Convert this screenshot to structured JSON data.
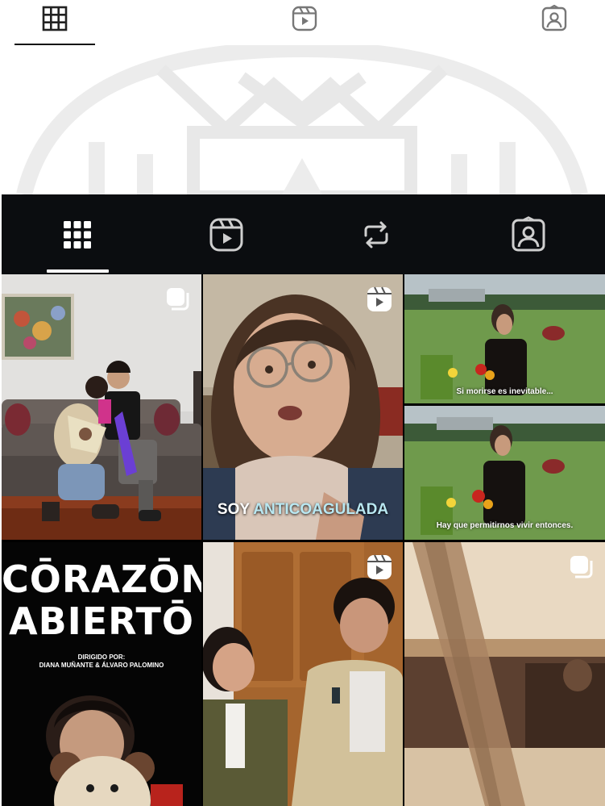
{
  "top_tabs": [
    {
      "id": "posts",
      "icon": "grid-icon",
      "active": true
    },
    {
      "id": "reels",
      "icon": "reels-icon",
      "active": false
    },
    {
      "id": "tagged",
      "icon": "tagged-icon",
      "active": false
    }
  ],
  "dark_tabs": [
    {
      "id": "posts",
      "icon": "grid-icon",
      "active": true
    },
    {
      "id": "reels",
      "icon": "reels-icon",
      "active": false
    },
    {
      "id": "reposts",
      "icon": "repost-icon",
      "active": false
    },
    {
      "id": "tagged",
      "icon": "tagged-icon",
      "active": false
    }
  ],
  "posts": {
    "p1": {
      "type": "carousel",
      "badge_icon": "carousel-icon",
      "description": "couple on grey sofa"
    },
    "p2": {
      "type": "reel",
      "badge_icon": "reels-icon",
      "overlay_prefix": "SOY ",
      "overlay_accent": "ANTICOAGULADA"
    },
    "p3": {
      "caption": "Si morirse es inevitable..."
    },
    "p4": {
      "caption": "Hay que permitirnos vivir entonces."
    },
    "p5": {
      "type": "poster",
      "title_line1": "CŌRAZŌN",
      "title_line2": "ABIERTŌ",
      "credit_line1": "DIRIGIDO POR:",
      "credit_line2": "DIANA MUÑANTE & ÁLVARO PALOMINO"
    },
    "p6": {
      "type": "reel",
      "badge_icon": "reels-icon"
    },
    "p7": {
      "type": "carousel",
      "badge_icon": "carousel-icon"
    }
  },
  "colors": {
    "dark_bar": "#0b0d10",
    "overlay_accent": "#b9e8f2"
  }
}
